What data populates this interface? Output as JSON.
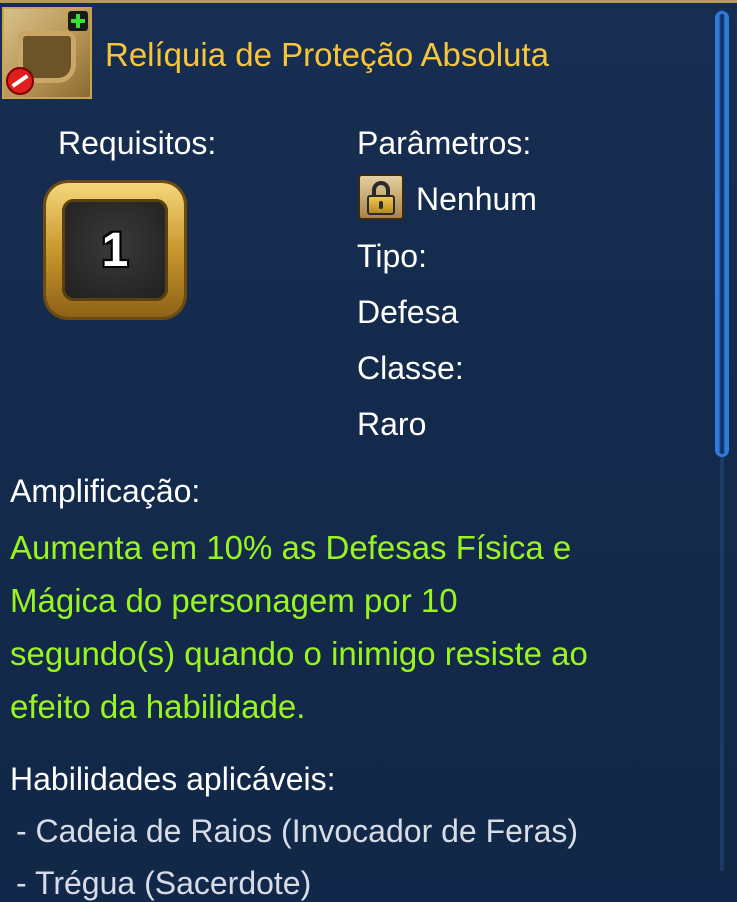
{
  "item": {
    "name": "Relíquia de Proteção Absoluta",
    "icon": "relic-icon",
    "title_color": "#f6c53a"
  },
  "requirements": {
    "label": "Requisitos:",
    "level": "1"
  },
  "parameters": {
    "label": "Parâmetros:",
    "lock_icon": "lock-icon",
    "value": "Nenhum"
  },
  "type": {
    "label": "Tipo:",
    "value": "Defesa"
  },
  "class": {
    "label": "Classe:",
    "value": "Raro"
  },
  "amplification": {
    "label": "Amplificação:",
    "lines": [
      "Aumenta em 10% as Defesas Física e",
      "Mágica do personagem por 10",
      "segundo(s) quando o inimigo resiste ao",
      "efeito da habilidade."
    ],
    "color": "#9af51f"
  },
  "applicable_skills": {
    "label": "Habilidades aplicáveis:",
    "items": [
      "- Cadeia de Raios (Invocador de Feras)",
      "- Trégua (Sacerdote)"
    ]
  }
}
